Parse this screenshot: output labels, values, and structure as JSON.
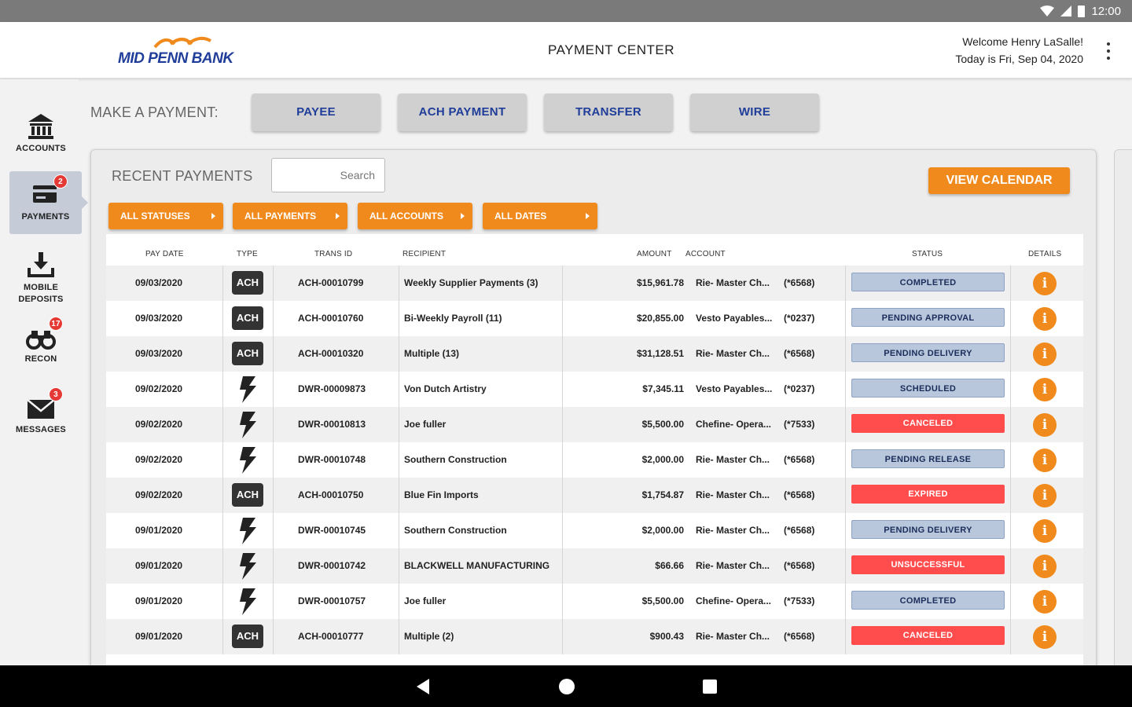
{
  "statusbar": {
    "time": "12:00"
  },
  "header": {
    "brand": "MID PENN BANK",
    "title": "PAYMENT CENTER",
    "welcome": "Welcome Henry LaSalle!",
    "date": "Today is Fri, Sep 04, 2020"
  },
  "sidenav": [
    {
      "label": "ACCOUNTS",
      "icon": "bank-icon",
      "badge": ""
    },
    {
      "label": "PAYMENTS",
      "icon": "payments-icon",
      "badge": "2"
    },
    {
      "label": "MOBILE DEPOSITS",
      "icon": "deposit-icon",
      "badge": ""
    },
    {
      "label": "RECON",
      "icon": "binoculars-icon",
      "badge": "17"
    },
    {
      "label": "MESSAGES",
      "icon": "envelope-icon",
      "badge": "3"
    }
  ],
  "make_payment": {
    "label": "MAKE A PAYMENT:",
    "buttons": [
      "PAYEE",
      "ACH PAYMENT",
      "TRANSFER",
      "WIRE"
    ]
  },
  "recent": {
    "label": "RECENT PAYMENTS",
    "search_placeholder": "Search",
    "view_calendar": "VIEW CALENDAR",
    "filters": [
      "ALL STATUSES",
      "ALL PAYMENTS",
      "ALL ACCOUNTS",
      "ALL DATES"
    ]
  },
  "table": {
    "columns": [
      "PAY DATE",
      "TYPE",
      "TRANS ID",
      "RECIPIENT",
      "AMOUNT",
      "ACCOUNT",
      "STATUS",
      "DETAILS"
    ],
    "rows": [
      {
        "date": "09/03/2020",
        "type": "ACH",
        "trans_id": "ACH-00010799",
        "recipient": "Weekly Supplier Payments (3)",
        "amount": "$15,961.78",
        "account": "Rie- Master Ch...",
        "acct_no": "(*6568)",
        "status": "COMPLETED",
        "status_color": "blue"
      },
      {
        "date": "09/03/2020",
        "type": "ACH",
        "trans_id": "ACH-00010760",
        "recipient": "Bi-Weekly Payroll (11)",
        "amount": "$20,855.00",
        "account": "Vesto Payables...",
        "acct_no": "(*0237)",
        "status": "PENDING APPROVAL",
        "status_color": "blue"
      },
      {
        "date": "09/03/2020",
        "type": "ACH",
        "trans_id": "ACH-00010320",
        "recipient": "Multiple (13)",
        "amount": "$31,128.51",
        "account": "Rie- Master Ch...",
        "acct_no": "(*6568)",
        "status": "PENDING DELIVERY",
        "status_color": "blue"
      },
      {
        "date": "09/02/2020",
        "type": "WIRE",
        "trans_id": "DWR-00009873",
        "recipient": "Von Dutch Artistry",
        "amount": "$7,345.11",
        "account": "Vesto Payables...",
        "acct_no": "(*0237)",
        "status": "SCHEDULED",
        "status_color": "blue"
      },
      {
        "date": "09/02/2020",
        "type": "WIRE",
        "trans_id": "DWR-00010813",
        "recipient": "Joe fuller",
        "amount": "$5,500.00",
        "account": "Chefine- Opera...",
        "acct_no": "(*7533)",
        "status": "CANCELED",
        "status_color": "red"
      },
      {
        "date": "09/02/2020",
        "type": "WIRE",
        "trans_id": "DWR-00010748",
        "recipient": "Southern Construction",
        "amount": "$2,000.00",
        "account": "Rie- Master Ch...",
        "acct_no": "(*6568)",
        "status": "PENDING RELEASE",
        "status_color": "blue"
      },
      {
        "date": "09/02/2020",
        "type": "ACH",
        "trans_id": "ACH-00010750",
        "recipient": "Blue Fin Imports",
        "amount": "$1,754.87",
        "account": "Rie- Master Ch...",
        "acct_no": "(*6568)",
        "status": "EXPIRED",
        "status_color": "red"
      },
      {
        "date": "09/01/2020",
        "type": "WIRE",
        "trans_id": "DWR-00010745",
        "recipient": "Southern Construction",
        "amount": "$2,000.00",
        "account": "Rie- Master Ch...",
        "acct_no": "(*6568)",
        "status": "PENDING DELIVERY",
        "status_color": "blue"
      },
      {
        "date": "09/01/2020",
        "type": "WIRE",
        "trans_id": "DWR-00010742",
        "recipient": "BLACKWELL MANUFACTURING",
        "amount": "$66.66",
        "account": "Rie- Master Ch...",
        "acct_no": "(*6568)",
        "status": "UNSUCCESSFUL",
        "status_color": "red"
      },
      {
        "date": "09/01/2020",
        "type": "WIRE",
        "trans_id": "DWR-00010757",
        "recipient": "Joe fuller",
        "amount": "$5,500.00",
        "account": "Chefine- Opera...",
        "acct_no": "(*7533)",
        "status": "COMPLETED",
        "status_color": "blue"
      },
      {
        "date": "09/01/2020",
        "type": "ACH",
        "trans_id": "ACH-00010777",
        "recipient": "Multiple (2)",
        "amount": "$900.43",
        "account": "Rie- Master Ch...",
        "acct_no": "(*6568)",
        "status": "CANCELED",
        "status_color": "red"
      }
    ]
  },
  "colors": {
    "accent": "#f08a1c",
    "brand": "#1f3d99",
    "error": "#ff4d4d",
    "neutral_status": "#b8c7dc"
  }
}
